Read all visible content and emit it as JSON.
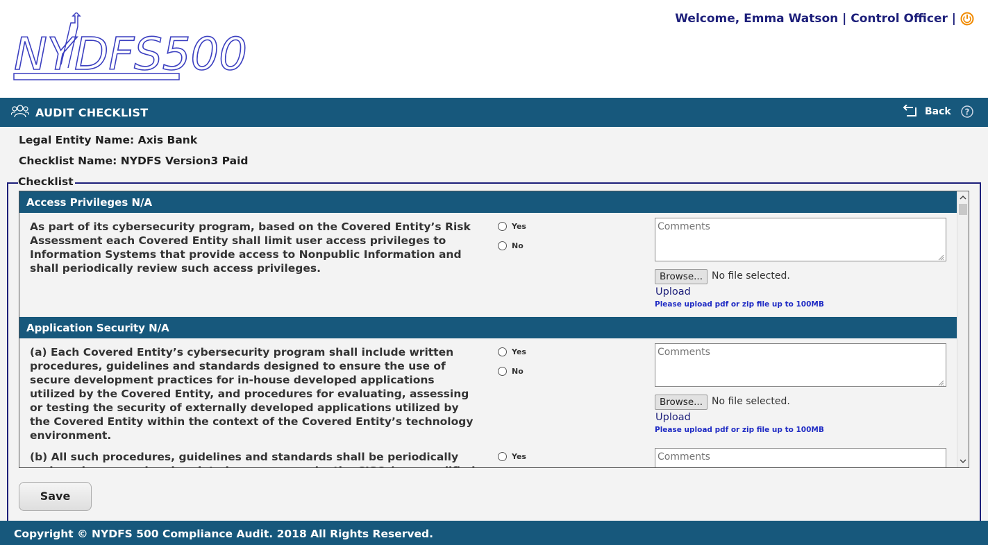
{
  "header": {
    "logo_text": "NYDFS500",
    "welcome_text": "Welcome, Emma Watson | Control Officer |"
  },
  "titlebar": {
    "title": "AUDIT CHECKLIST",
    "back_label": "Back",
    "help_icon": "help-icon"
  },
  "info": {
    "legal_entity": "Legal Entity Name: Axis Bank",
    "checklist_name": "Checklist Name: NYDFS Version3 Paid"
  },
  "checklist": {
    "legend": "Checklist",
    "sections": [
      {
        "heading": "Access Privileges N/A",
        "questions": [
          {
            "text": "As part of its cybersecurity program, based on the Covered Entity’s Risk Assessment each Covered Entity shall limit user access privileges to Information Systems that provide access to Nonpublic Information and shall periodically review such access privileges.",
            "yes_label": "Yes",
            "no_label": "No",
            "comments_placeholder": "Comments",
            "browse_label": "Browse...",
            "file_status": "No file selected.",
            "upload_label": "Upload",
            "upload_hint": "Please upload pdf or zip file up to 100MB"
          }
        ]
      },
      {
        "heading": "Application Security N/A",
        "questions": [
          {
            "text": "(a) Each Covered Entity’s cybersecurity program shall include written procedures, guidelines and standards designed to ensure the use of secure development practices for in-house developed applications utilized by the Covered Entity, and procedures for evaluating, assessing or testing the security of externally developed applications utilized by the Covered Entity within the context of the Covered Entity’s technology environment.",
            "yes_label": "Yes",
            "no_label": "No",
            "comments_placeholder": "Comments",
            "browse_label": "Browse...",
            "file_status": "No file selected.",
            "upload_label": "Upload",
            "upload_hint": "Please upload pdf or zip file up to 100MB"
          },
          {
            "text": "(b) All such procedures, guidelines and standards shall be periodically reviewed, assessed and updated as necessary by the CISO (or a qualified designee) of the Covered Entity.",
            "yes_label": "Yes",
            "comments_placeholder": "Comments"
          }
        ]
      }
    ]
  },
  "save_label": "Save",
  "footer": {
    "copyright": "Copyright © NYDFS 500 Compliance Audit. 2018 All Rights Reserved."
  },
  "colors": {
    "brand_bar": "#17587c",
    "brand_text": "#1d1f7a",
    "power_icon": "#f08a00",
    "hint_text": "#1f2bc4"
  }
}
